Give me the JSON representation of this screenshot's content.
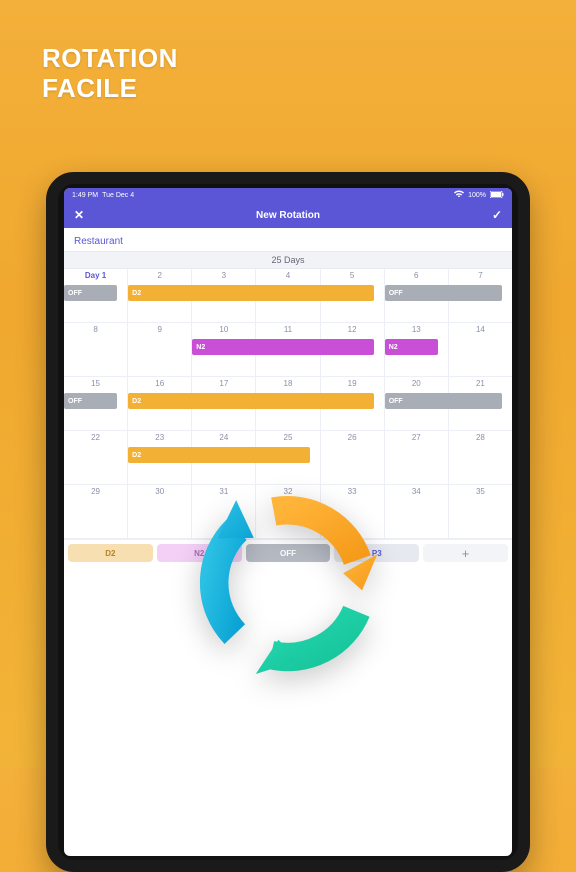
{
  "headline": {
    "line1": "ROTATION",
    "line2": "FACILE"
  },
  "statusbar": {
    "time": "1:49 PM",
    "date": "Tue Dec 4",
    "wifi": "wifi-icon",
    "battery_pct": "100%"
  },
  "navbar": {
    "title": "New Rotation",
    "close": "✕",
    "confirm": "✓"
  },
  "restaurant_label": "Restaurant",
  "subheader": "25 Days",
  "day1_label": "Day 1",
  "rows": [
    {
      "days": [
        {
          "num": "Day 1",
          "selected": true,
          "event": {
            "kind": "OFF",
            "seg": "solo"
          }
        },
        {
          "num": "2",
          "event": {
            "kind": "D2",
            "seg": "startCap"
          }
        },
        {
          "num": "3",
          "event": {
            "kind": "D2",
            "seg": "through"
          }
        },
        {
          "num": "4",
          "event": {
            "kind": "D2",
            "seg": "through"
          }
        },
        {
          "num": "5",
          "event": {
            "kind": "D2",
            "seg": "endCap"
          }
        },
        {
          "num": "6",
          "event": {
            "kind": "OFF",
            "seg": "startCap"
          }
        },
        {
          "num": "7",
          "event": {
            "kind": "OFF",
            "seg": "endCap"
          }
        }
      ]
    },
    {
      "days": [
        {
          "num": "8"
        },
        {
          "num": "9"
        },
        {
          "num": "10",
          "event": {
            "kind": "N2",
            "seg": "startCap"
          }
        },
        {
          "num": "11",
          "event": {
            "kind": "N2",
            "seg": "through"
          }
        },
        {
          "num": "12",
          "event": {
            "kind": "N2",
            "seg": "endCap"
          }
        },
        {
          "num": "13",
          "event": {
            "kind": "N2",
            "seg": "solo"
          }
        },
        {
          "num": "14"
        }
      ]
    },
    {
      "days": [
        {
          "num": "15",
          "event": {
            "kind": "OFF",
            "seg": "solo"
          }
        },
        {
          "num": "16",
          "event": {
            "kind": "D2",
            "seg": "startCap"
          }
        },
        {
          "num": "17",
          "event": {
            "kind": "D2",
            "seg": "through"
          }
        },
        {
          "num": "18",
          "event": {
            "kind": "D2",
            "seg": "through"
          }
        },
        {
          "num": "19",
          "event": {
            "kind": "D2",
            "seg": "endCap"
          }
        },
        {
          "num": "20",
          "event": {
            "kind": "OFF",
            "seg": "startCap"
          }
        },
        {
          "num": "21",
          "event": {
            "kind": "OFF",
            "seg": "endCap"
          }
        }
      ]
    },
    {
      "days": [
        {
          "num": "22"
        },
        {
          "num": "23",
          "event": {
            "kind": "D2",
            "seg": "startCap"
          }
        },
        {
          "num": "24",
          "event": {
            "kind": "D2",
            "seg": "through"
          }
        },
        {
          "num": "25",
          "event": {
            "kind": "D2",
            "seg": "endCap"
          }
        },
        {
          "num": "26"
        },
        {
          "num": "27"
        },
        {
          "num": "28"
        }
      ]
    },
    {
      "days": [
        {
          "num": "29"
        },
        {
          "num": "30"
        },
        {
          "num": "31"
        },
        {
          "num": "32"
        },
        {
          "num": "33"
        },
        {
          "num": "34"
        },
        {
          "num": "35"
        }
      ]
    }
  ],
  "legend": {
    "d2": "D2",
    "n2": "N2",
    "off": "OFF",
    "p3": "P3",
    "add": "+"
  },
  "event_labels": {
    "OFF": "OFF",
    "D2": "D2",
    "N2": "N2"
  }
}
